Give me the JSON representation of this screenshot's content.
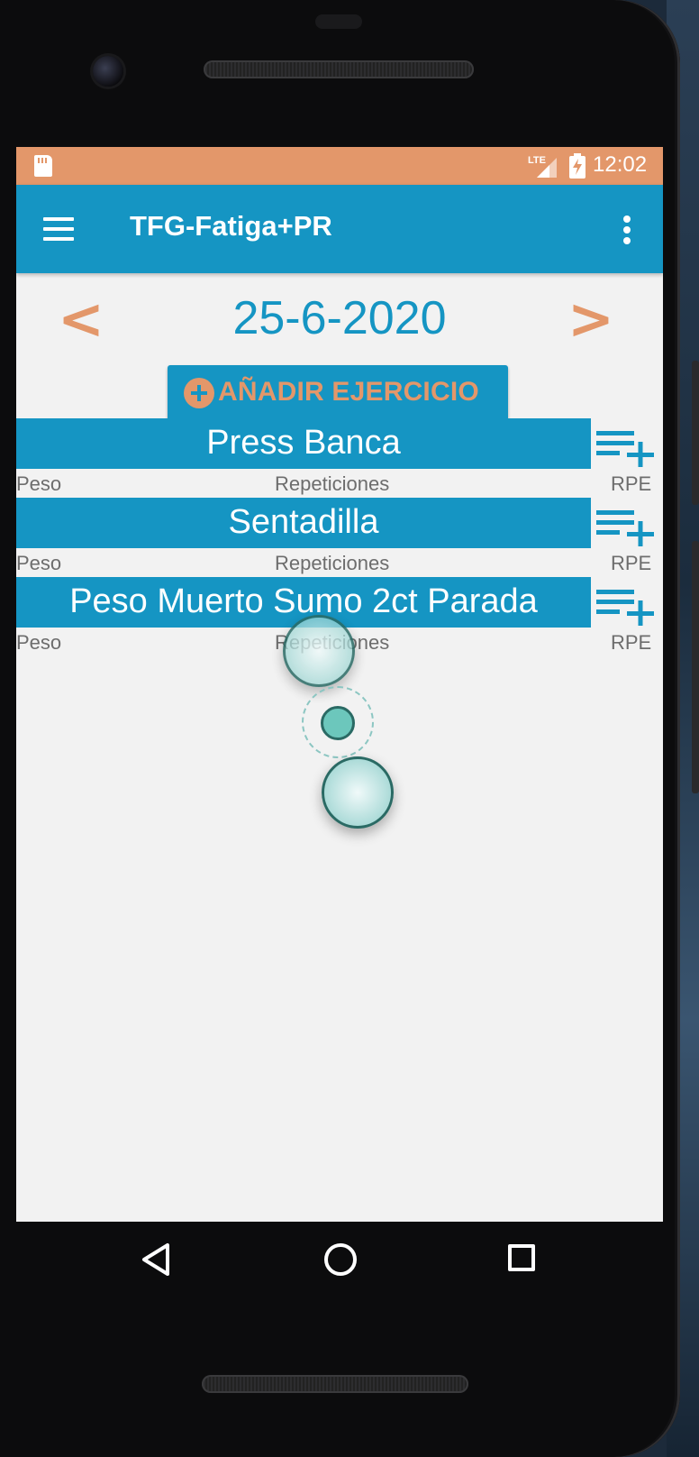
{
  "status_bar": {
    "time": "12:02",
    "icons": [
      "sd-card-icon",
      "lte-signal-icon",
      "battery-charging-icon"
    ],
    "background": "#e3976a"
  },
  "app_bar": {
    "title": "TFG-Fatiga+PR",
    "background": "#1595c3",
    "left_icon": "menu-icon",
    "right_icon": "overflow-menu-icon"
  },
  "date_nav": {
    "prev": "<",
    "date": "25-6-2020",
    "next": ">"
  },
  "add_exercise": {
    "label": "AÑADIR EJERCICIO",
    "icon": "add-circle-icon"
  },
  "exercises": [
    {
      "name": "Press Banca",
      "columns": [
        "Peso",
        "Repeticiones",
        "RPE"
      ]
    },
    {
      "name": "Sentadilla",
      "columns": [
        "Peso",
        "Repeticiones",
        "RPE"
      ]
    },
    {
      "name": "Peso Muerto Sumo 2ct Parada",
      "columns": [
        "Peso",
        "Repeticiones",
        "RPE"
      ]
    }
  ],
  "colors": {
    "accent_blue": "#1595c3",
    "accent_orange": "#e3976a",
    "background": "#f2f2f2",
    "label_gray": "#6d6d6d"
  },
  "nav_bar": {
    "icons": [
      "back-icon",
      "home-icon",
      "recents-icon"
    ]
  }
}
